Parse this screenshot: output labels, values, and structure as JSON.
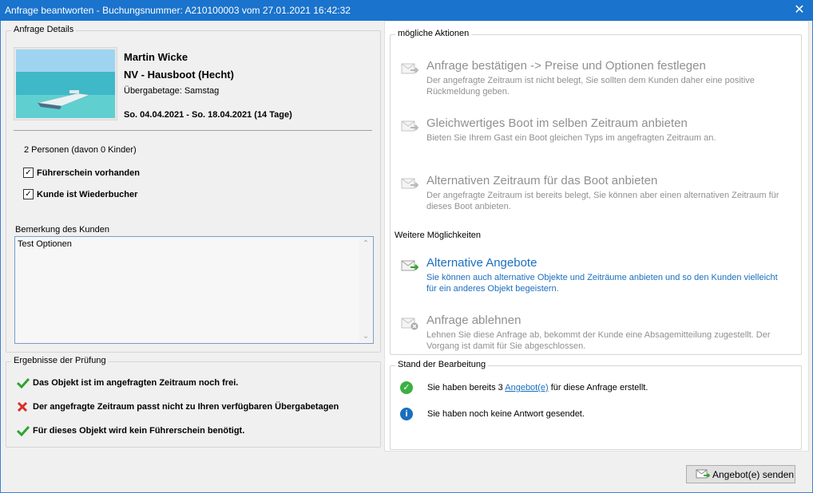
{
  "window": {
    "title": "Anfrage beantworten - Buchungsnummer: A210100003 vom 27.01.2021 16:42:32",
    "close": "✕"
  },
  "details": {
    "legend": "Anfrage Details",
    "name": "Martin Wicke",
    "boat": "NV - Hausboot (Hecht)",
    "handover": "Übergabetage: Samstag",
    "period": "So. 04.04.2021 - So. 18.04.2021 (14 Tage)",
    "persons": "2 Personen (davon 0 Kinder)",
    "license": "Führerschein vorhanden",
    "rebooker": "Kunde ist Wiederbucher",
    "remark_label": "Bemerkung des Kunden",
    "remark_text": "Test Optionen"
  },
  "results": {
    "legend": "Ergebnisse der Prüfung",
    "items": [
      {
        "status": "ok",
        "text": "Das Objekt ist im angefragten Zeitraum noch frei."
      },
      {
        "status": "error",
        "text": "Der angefragte Zeitraum passt nicht zu Ihren verfügbaren Übergabetagen"
      },
      {
        "status": "ok",
        "text": "Für dieses Objekt wird kein Führerschein benötigt."
      }
    ]
  },
  "actions": {
    "legend": "mögliche Aktionen",
    "items": [
      {
        "title": "Anfrage bestätigen -> Preise und Optionen festlegen",
        "desc1": "Der angefragte Zeitraum ist nicht belegt, Sie sollten dem Kunden daher eine positive",
        "desc2": "Rückmeldung geben."
      },
      {
        "title": "Gleichwertiges Boot im selben Zeitraum anbieten",
        "desc1": "Bieten Sie Ihrem Gast ein Boot gleichen Typs im angefragten Zeitraum an.",
        "desc2": ""
      },
      {
        "title": "Alternativen Zeitraum für das Boot anbieten",
        "desc1": "Der angefragte Zeitraum ist bereits belegt, Sie können aber einen alternativen Zeitraum für",
        "desc2": "dieses Boot anbieten."
      }
    ],
    "more_label": "Weitere Möglichkeiten",
    "more": [
      {
        "title": "Alternative Angebote",
        "desc1": "Sie können auch alternative Objekte und Zeiträume anbieten und so den Kunden vielleicht",
        "desc2": "für ein anderes Objekt begeistern."
      },
      {
        "title": "Anfrage ablehnen",
        "desc1": "Lehnen Sie diese Anfrage ab, bekommt der Kunde eine Absagemitteilung zugestellt. Der",
        "desc2": "Vorgang ist damit für Sie abgeschlossen."
      }
    ]
  },
  "status": {
    "legend": "Stand der Bearbeitung",
    "line1_pre": "Sie haben bereits 3 ",
    "line1_link": "Angebot(e)",
    "line1_post": " für diese Anfrage erstellt.",
    "line2": "Sie haben noch keine Antwort gesendet."
  },
  "footer": {
    "send_button": "Angebot(e) senden"
  },
  "colors": {
    "titlebar": "#1a73cc",
    "link": "#1a6fbd",
    "ok": "#2ea52e",
    "error": "#d93025",
    "info": "#1a6fbd"
  }
}
